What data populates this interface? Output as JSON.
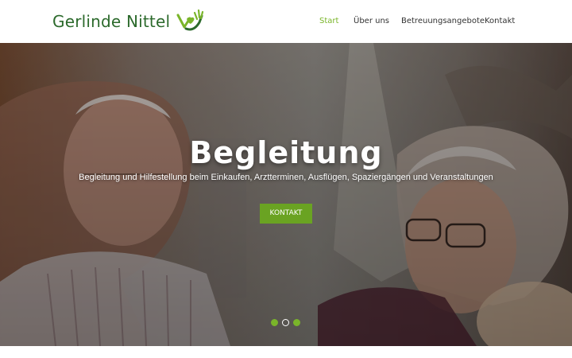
{
  "brand": {
    "name": "Gerlinde Nittel",
    "logo_icon": "heart-hand-icon",
    "logo_color": "#2c6a2c",
    "accent_color": "#7ab52a"
  },
  "nav": {
    "items": [
      {
        "label": "Start",
        "active": true
      },
      {
        "label": "Über uns",
        "active": false
      },
      {
        "label": "Betreuungsangebote",
        "active": false
      },
      {
        "label": "Kontakt",
        "active": false
      }
    ]
  },
  "hero": {
    "title": "Begleitung",
    "subtitle": "Begleitung und Hilfestellung beim Einkaufen, Arztterminen, Ausflügen, Spaziergängen und Veranstaltungen",
    "cta_label": "KONTAKT",
    "cta_color": "#6aa322",
    "slides": {
      "count": 3,
      "current": 2
    }
  }
}
